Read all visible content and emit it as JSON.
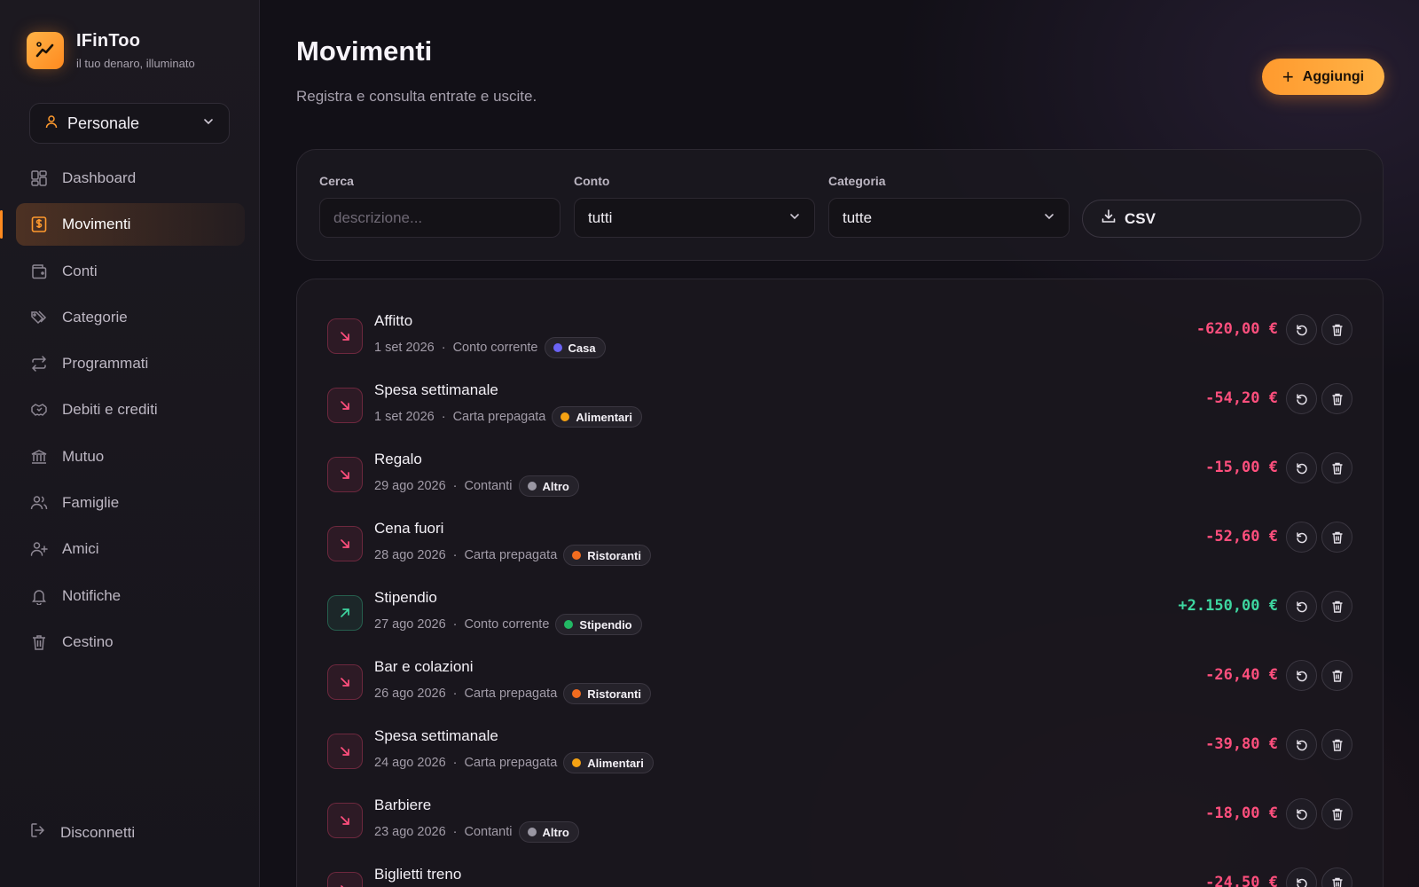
{
  "app": {
    "name": "IFinToo",
    "tagline": "il tuo denaro, illuminato"
  },
  "profile": {
    "label": "Personale"
  },
  "sidebar": {
    "items": [
      {
        "label": "Dashboard",
        "icon": "dashboard-icon"
      },
      {
        "label": "Movimenti",
        "icon": "receipt-icon",
        "active": true
      },
      {
        "label": "Conti",
        "icon": "wallet-icon"
      },
      {
        "label": "Categorie",
        "icon": "tags-icon"
      },
      {
        "label": "Programmati",
        "icon": "repeat-icon"
      },
      {
        "label": "Debiti e crediti",
        "icon": "handshake-icon"
      },
      {
        "label": "Mutuo",
        "icon": "bank-icon"
      },
      {
        "label": "Famiglie",
        "icon": "users-icon"
      },
      {
        "label": "Amici",
        "icon": "user-plus-icon"
      },
      {
        "label": "Notifiche",
        "icon": "bell-icon"
      },
      {
        "label": "Cestino",
        "icon": "trash-icon"
      }
    ],
    "logout": "Disconnetti"
  },
  "header": {
    "title": "Movimenti",
    "subtitle": "Registra e consulta entrate e uscite.",
    "add_label": "Aggiungi"
  },
  "filters": {
    "search": {
      "label": "Cerca",
      "placeholder": "descrizione..."
    },
    "account": {
      "label": "Conto",
      "value": "tutti"
    },
    "category": {
      "label": "Categoria",
      "value": "tutte"
    },
    "csv_label": "CSV"
  },
  "colors": {
    "accent": "#ff9a2e",
    "negative": "#ff4f7d",
    "positive": "#3ed6a0",
    "cat_casa": "#6b63f5",
    "cat_alimentari": "#f5a213",
    "cat_altro": "#9a97a3",
    "cat_ristoranti": "#f26c1f",
    "cat_stipendio": "#22b864"
  },
  "transactions": [
    {
      "title": "Affitto",
      "date": "1 set 2026",
      "account": "Conto corrente",
      "category": "Casa",
      "cat_color": "#6b63f5",
      "amount": "-620,00 €",
      "type": "out"
    },
    {
      "title": "Spesa settimanale",
      "date": "1 set 2026",
      "account": "Carta prepagata",
      "category": "Alimentari",
      "cat_color": "#f5a213",
      "amount": "-54,20 €",
      "type": "out"
    },
    {
      "title": "Regalo",
      "date": "29 ago 2026",
      "account": "Contanti",
      "category": "Altro",
      "cat_color": "#9a97a3",
      "amount": "-15,00 €",
      "type": "out"
    },
    {
      "title": "Cena fuori",
      "date": "28 ago 2026",
      "account": "Carta prepagata",
      "category": "Ristoranti",
      "cat_color": "#f26c1f",
      "amount": "-52,60 €",
      "type": "out"
    },
    {
      "title": "Stipendio",
      "date": "27 ago 2026",
      "account": "Conto corrente",
      "category": "Stipendio",
      "cat_color": "#22b864",
      "amount": "+2.150,00 €",
      "type": "in"
    },
    {
      "title": "Bar e colazioni",
      "date": "26 ago 2026",
      "account": "Carta prepagata",
      "category": "Ristoranti",
      "cat_color": "#f26c1f",
      "amount": "-26,40 €",
      "type": "out"
    },
    {
      "title": "Spesa settimanale",
      "date": "24 ago 2026",
      "account": "Carta prepagata",
      "category": "Alimentari",
      "cat_color": "#f5a213",
      "amount": "-39,80 €",
      "type": "out"
    },
    {
      "title": "Barbiere",
      "date": "23 ago 2026",
      "account": "Contanti",
      "category": "Altro",
      "cat_color": "#9a97a3",
      "amount": "-18,00 €",
      "type": "out"
    },
    {
      "title": "Biglietti treno",
      "amount": "-24,50 €",
      "type": "out"
    }
  ]
}
